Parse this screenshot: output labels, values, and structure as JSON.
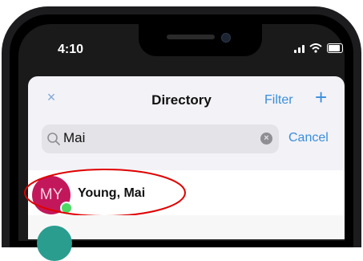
{
  "status_bar": {
    "time": "4:10"
  },
  "header": {
    "title": "Directory",
    "filter_label": "Filter",
    "add_symbol": "+",
    "close_symbol": "×"
  },
  "search": {
    "value": "Mai",
    "cancel_label": "Cancel",
    "clear_symbol": "×"
  },
  "results": [
    {
      "initials": "MY",
      "name": "Young, Mai",
      "status": "online"
    }
  ],
  "colors": {
    "accent": "#3a8edc",
    "avatar": "#c2185b",
    "presence_online": "#4cd964",
    "annotation": "#e00000"
  }
}
